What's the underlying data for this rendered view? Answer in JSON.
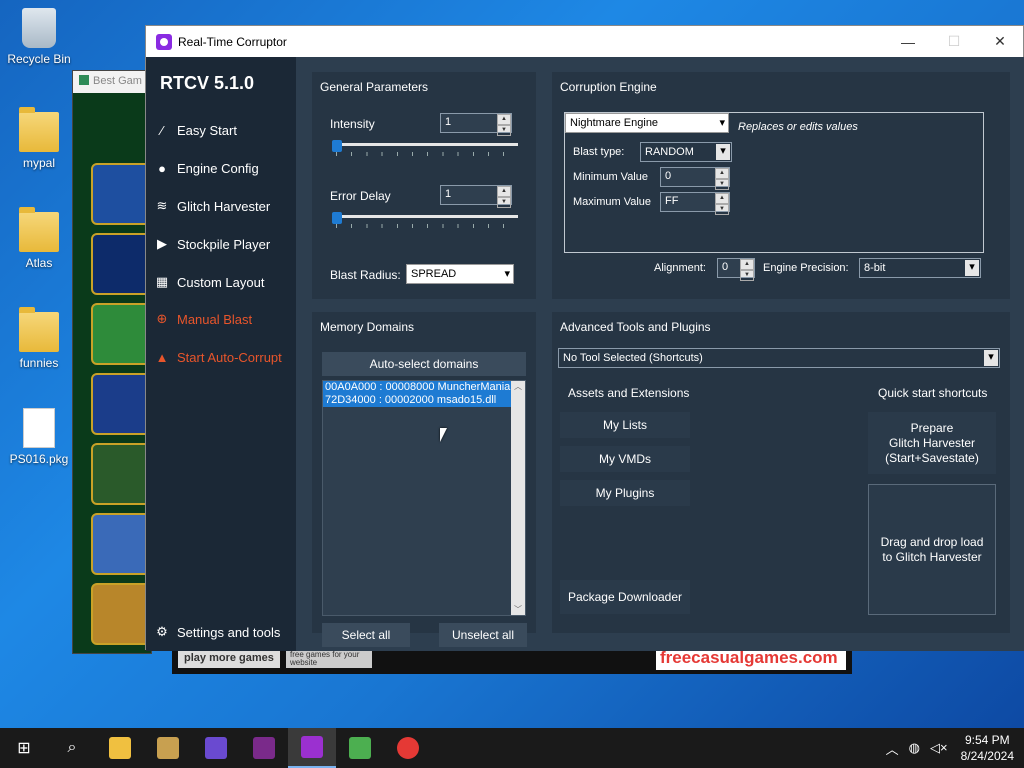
{
  "desktop": {
    "icons": [
      {
        "label": "Recycle Bin"
      },
      {
        "label": "mypal"
      },
      {
        "label": "Atlas"
      },
      {
        "label": "funnies"
      },
      {
        "label": "PS016.pkg"
      }
    ]
  },
  "background_game": {
    "title": "Best Gam",
    "footer_play": "play more games",
    "footer_free": "free games for your website",
    "footer_brand": "freecasualgames.com"
  },
  "window": {
    "title": "Real-Time Corruptor",
    "minimize_icon": "minimize-icon",
    "maximize_icon": "maximize-icon",
    "close_icon": "close-icon"
  },
  "sidebar": {
    "brand": "RTCV 5.1.0",
    "items": [
      {
        "label": "Easy Start",
        "icon": "wand-icon"
      },
      {
        "label": "Engine Config",
        "icon": "gamepad-icon"
      },
      {
        "label": "Glitch Harvester",
        "icon": "layers-icon"
      },
      {
        "label": "Stockpile Player",
        "icon": "play-icon"
      },
      {
        "label": "Custom Layout",
        "icon": "grid-icon"
      },
      {
        "label": "Manual Blast",
        "icon": "target-icon"
      },
      {
        "label": "Start Auto-Corrupt",
        "icon": "flame-icon"
      }
    ],
    "settings": "Settings and tools",
    "accent_color": "#e8552b"
  },
  "general_parameters": {
    "title": "General Parameters",
    "intensity_label": "Intensity",
    "intensity_value": "1",
    "intensity_fraction": 0,
    "error_delay_label": "Error Delay",
    "error_delay_value": "1",
    "error_delay_fraction": 0,
    "blast_radius_label": "Blast Radius:",
    "blast_radius_value": "SPREAD"
  },
  "corruption_engine": {
    "title": "Corruption Engine",
    "engine": "Nightmare Engine",
    "engine_desc": "Replaces or edits values",
    "blast_type_label": "Blast type:",
    "blast_type_value": "RANDOM",
    "min_label": "Minimum Value",
    "min_value": "0",
    "max_label": "Maximum Value",
    "max_value": "FF",
    "alignment_label": "Alignment:",
    "alignment_value": "0",
    "precision_label": "Engine Precision:",
    "precision_value": "8-bit"
  },
  "memory_domains": {
    "title": "Memory Domains",
    "auto_select": "Auto-select domains",
    "domains": [
      "00A0A000 : 00008000 MuncherMania",
      "72D34000 : 00002000 msado15.dll"
    ],
    "select_all": "Select all",
    "unselect_all": "Unselect all"
  },
  "advanced_tools": {
    "title": "Advanced Tools and Plugins",
    "tool_select": "No Tool Selected (Shortcuts)",
    "assets_title": "Assets and Extensions",
    "my_lists": "My Lists",
    "my_vmds": "My VMDs",
    "my_plugins": "My Plugins",
    "package_downloader": "Package Downloader",
    "quick_start_title": "Quick start shortcuts",
    "prepare_gh": "Prepare\nGlitch Harvester\n(Start+Savestate)",
    "drag_drop": "Drag and drop load\nto Glitch Harvester"
  },
  "taskbar": {
    "items": [
      "windows-icon",
      "search-icon",
      "file-explorer-icon",
      "app-icon-1",
      "app-icon-2",
      "app-icon-3",
      "rtcv-icon",
      "app-icon-4",
      "app-icon-5"
    ],
    "time": "9:54 PM",
    "date": "8/24/2024"
  }
}
